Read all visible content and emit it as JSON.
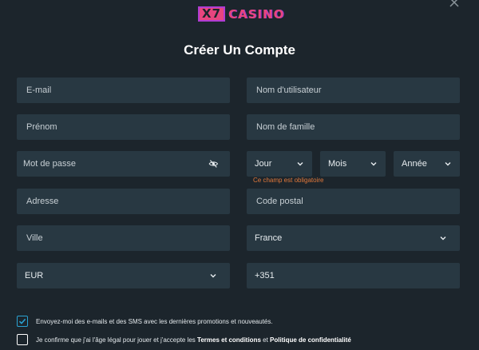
{
  "logo": {
    "x7": "X7",
    "casino": "CASINO"
  },
  "title": "Créer Un Compte",
  "fields": {
    "email": "E-mail",
    "username": "Nom d'utilisateur",
    "firstname": "Prénom",
    "lastname": "Nom de famille",
    "password": "Mot de passe",
    "address": "Adresse",
    "postal": "Code postal",
    "city": "Ville"
  },
  "dob": {
    "day": "Jour",
    "month": "Mois",
    "year": "Année"
  },
  "dob_error": "Ce champ est obligatoire",
  "country": "France",
  "currency": "EUR",
  "phone_prefix": "+351",
  "consent": {
    "marketing": "Envoyez-moi des e-mails et des SMS avec les dernières promotions et nouveautés.",
    "terms_pre": "Je confirme que j'ai l'âge légal pour jouer et j'accepte les ",
    "terms_link": "Termes et conditions",
    "terms_mid": " et ",
    "privacy_link": "Politique de confidentialité"
  },
  "colors": {
    "field_bg": "#283842",
    "page_bg": "#1c252c",
    "error": "#e0773a",
    "accent": "#2aa2d2",
    "brand": "#e8457f"
  }
}
